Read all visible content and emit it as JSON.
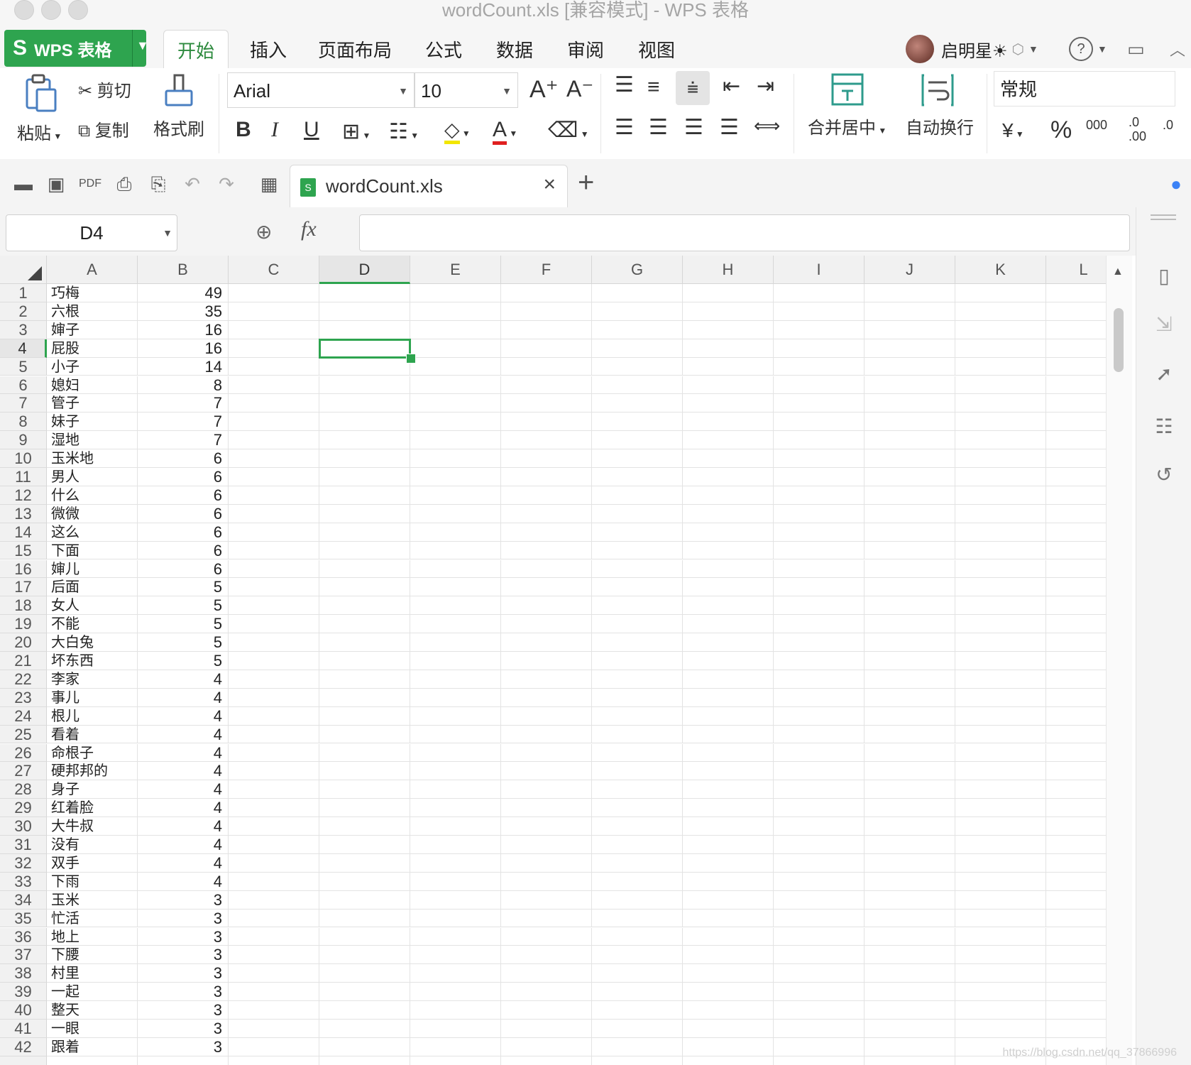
{
  "window": {
    "title": "wordCount.xls [兼容模式] - WPS 表格"
  },
  "app_button": {
    "label": "WPS 表格"
  },
  "tabs": [
    "开始",
    "插入",
    "页面布局",
    "公式",
    "数据",
    "审阅",
    "视图"
  ],
  "user": {
    "name": "启明星☀"
  },
  "ribbon": {
    "paste": "粘贴",
    "cut": "剪切",
    "copy": "复制",
    "format_painter": "格式刷",
    "font_name": "Arial",
    "font_size": "10",
    "merge_center": "合并居中",
    "wrap_text": "自动换行",
    "number_format": "常规",
    "thousands": "000",
    "dec_increase": ".0\n.00",
    "dec_decrease": ".0",
    "percent": "%"
  },
  "document_tab": {
    "name": "wordCount.xls"
  },
  "formula_bar": {
    "name_box": "D4",
    "fx": "fx",
    "formula": ""
  },
  "columns": [
    "A",
    "B",
    "C",
    "D",
    "E",
    "F",
    "G",
    "H",
    "I",
    "J",
    "K",
    "L"
  ],
  "selected_cell": "D4",
  "rows": [
    {
      "n": "1",
      "a": "巧梅",
      "b": "49"
    },
    {
      "n": "2",
      "a": "六根",
      "b": "35"
    },
    {
      "n": "3",
      "a": "婶子",
      "b": "16"
    },
    {
      "n": "4",
      "a": "屁股",
      "b": "16"
    },
    {
      "n": "5",
      "a": "小子",
      "b": "14"
    },
    {
      "n": "6",
      "a": "媳妇",
      "b": "8"
    },
    {
      "n": "7",
      "a": "管子",
      "b": "7"
    },
    {
      "n": "8",
      "a": "妹子",
      "b": "7"
    },
    {
      "n": "9",
      "a": "湿地",
      "b": "7"
    },
    {
      "n": "10",
      "a": "玉米地",
      "b": "6"
    },
    {
      "n": "11",
      "a": "男人",
      "b": "6"
    },
    {
      "n": "12",
      "a": "什么",
      "b": "6"
    },
    {
      "n": "13",
      "a": "微微",
      "b": "6"
    },
    {
      "n": "14",
      "a": "这么",
      "b": "6"
    },
    {
      "n": "15",
      "a": "下面",
      "b": "6"
    },
    {
      "n": "16",
      "a": "婶儿",
      "b": "6"
    },
    {
      "n": "17",
      "a": "后面",
      "b": "5"
    },
    {
      "n": "18",
      "a": "女人",
      "b": "5"
    },
    {
      "n": "19",
      "a": "不能",
      "b": "5"
    },
    {
      "n": "20",
      "a": "大白兔",
      "b": "5"
    },
    {
      "n": "21",
      "a": "坏东西",
      "b": "5"
    },
    {
      "n": "22",
      "a": "李家",
      "b": "4"
    },
    {
      "n": "23",
      "a": "事儿",
      "b": "4"
    },
    {
      "n": "24",
      "a": "根儿",
      "b": "4"
    },
    {
      "n": "25",
      "a": "看着",
      "b": "4"
    },
    {
      "n": "26",
      "a": "命根子",
      "b": "4"
    },
    {
      "n": "27",
      "a": "硬邦邦的",
      "b": "4"
    },
    {
      "n": "28",
      "a": "身子",
      "b": "4"
    },
    {
      "n": "29",
      "a": "红着脸",
      "b": "4"
    },
    {
      "n": "30",
      "a": "大牛叔",
      "b": "4"
    },
    {
      "n": "31",
      "a": "没有",
      "b": "4"
    },
    {
      "n": "32",
      "a": "双手",
      "b": "4"
    },
    {
      "n": "33",
      "a": "下雨",
      "b": "4"
    },
    {
      "n": "34",
      "a": "玉米",
      "b": "3"
    },
    {
      "n": "35",
      "a": "忙活",
      "b": "3"
    },
    {
      "n": "36",
      "a": "地上",
      "b": "3"
    },
    {
      "n": "37",
      "a": "下腰",
      "b": "3"
    },
    {
      "n": "38",
      "a": "村里",
      "b": "3"
    },
    {
      "n": "39",
      "a": "一起",
      "b": "3"
    },
    {
      "n": "40",
      "a": "整天",
      "b": "3"
    },
    {
      "n": "41",
      "a": "一眼",
      "b": "3"
    },
    {
      "n": "42",
      "a": "跟着",
      "b": "3"
    }
  ],
  "watermark": "https://blog.csdn.net/qq_37866996",
  "colors": {
    "accent": "#2ea44f",
    "title_text": "#a5a5a5"
  }
}
